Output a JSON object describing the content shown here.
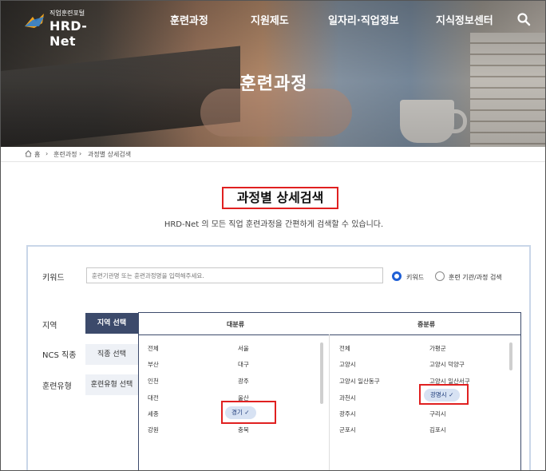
{
  "header": {
    "logo_small": "직업훈련포털",
    "logo_big": "HRD-Net",
    "nav": [
      "훈련과정",
      "지원제도",
      "일자리·직업정보",
      "지식정보센터"
    ],
    "search_icon": "search-icon"
  },
  "hero": {
    "title": "훈련과정"
  },
  "breadcrumb": {
    "home": "홈",
    "level1": "훈련과정",
    "level2": "과정별 상세검색"
  },
  "section": {
    "title": "과정별 상세검색",
    "description": "HRD-Net 의 모든 직업 훈련과정을 간편하게 검색할 수 있습니다."
  },
  "search": {
    "keyword_label": "키워드",
    "keyword_placeholder": "훈련기관명 또는 훈련과정명을 입력해주세요.",
    "radio_keyword": "키워드",
    "radio_institution": "훈련 기관/과정 검색",
    "region_label": "지역",
    "ncs_label": "NCS 직종",
    "type_label": "훈련유형",
    "region_button": "지역 선택",
    "ncs_button": "직종 선택",
    "type_button": "훈련유형 선택"
  },
  "dropdown": {
    "major_header": "대분류",
    "minor_header": "중분류",
    "major_col1": [
      "전체",
      "부산",
      "인천",
      "대전",
      "세종",
      "강원"
    ],
    "major_col2": [
      "서울",
      "대구",
      "광주",
      "울산",
      "경기",
      "충북"
    ],
    "minor_col1": [
      "전체",
      "고양시",
      "고양시 일산동구",
      "과천시",
      "광주시",
      "군포시"
    ],
    "minor_col2": [
      "가평군",
      "고양시 덕양구",
      "고양시 일산서구",
      "광명시",
      "구리시",
      "김포시"
    ],
    "selected_major": "경기",
    "selected_minor": "광명시",
    "check_glyph": "✓"
  },
  "colors": {
    "accent": "#3c4a6b",
    "highlight": "#e02020",
    "radio": "#1f5fd6"
  }
}
